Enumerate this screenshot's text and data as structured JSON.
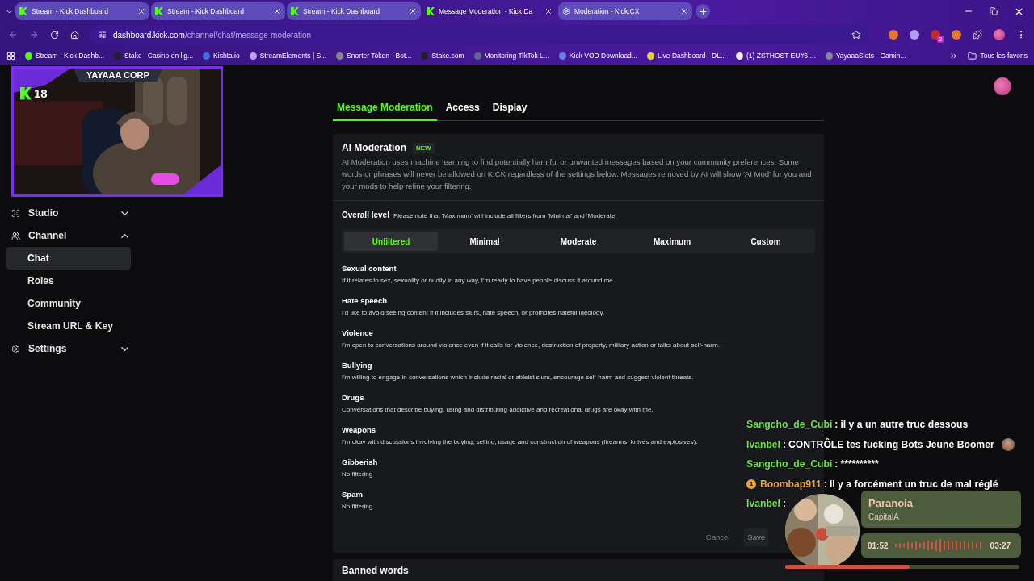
{
  "browser": {
    "tabs": [
      {
        "label": "Stream - Kick Dashboard",
        "kind": "kick",
        "selected": false
      },
      {
        "label": "Stream - Kick Dashboard",
        "kind": "kick",
        "selected": false
      },
      {
        "label": "Stream - Kick Dashboard",
        "kind": "kick",
        "selected": false
      },
      {
        "label": "Message Moderation - Kick Da",
        "kind": "kick",
        "selected": true
      },
      {
        "label": "Moderation - Kick.CX",
        "kind": "cx",
        "selected": false
      }
    ],
    "url": {
      "host": "dashboard.kick.com",
      "path": "/channel/chat/message-moderation"
    },
    "bookmarks": [
      "Stream - Kick Dashb...",
      "Stake : Casino en lig...",
      "Kishta.io",
      "StreamElements | S...",
      "Snorter Token - Bot...",
      "Stake.com",
      "Monitoring TikTok L...",
      "Kick VOD Download...",
      "Live Dashboard - DL...",
      "(1) ZSTHOST EU#6-...",
      "YayaaaSlots - Gamin..."
    ],
    "all_bookmarks": "Tous les favoris",
    "extension_badge": "2"
  },
  "webcam": {
    "banner": "YAYAAA CORP",
    "badge": "18"
  },
  "sidebar": {
    "items": [
      {
        "label": "Studio",
        "expanded": false
      },
      {
        "label": "Channel",
        "expanded": true,
        "children": [
          {
            "label": "Chat",
            "selected": true
          },
          {
            "label": "Roles",
            "selected": false
          },
          {
            "label": "Community",
            "selected": false
          },
          {
            "label": "Stream URL & Key",
            "selected": false
          }
        ]
      },
      {
        "label": "Settings",
        "expanded": false
      }
    ]
  },
  "page_tabs": [
    {
      "label": "Message Moderation",
      "selected": true
    },
    {
      "label": "Access",
      "selected": false
    },
    {
      "label": "Display",
      "selected": false
    }
  ],
  "ai_moderation": {
    "title": "AI Moderation",
    "badge": "NEW",
    "description": "AI Moderation uses machine learning to find potentially harmful or unwanted messages based on your community preferences. Some words or phrases will never be allowed on KICK regardless of the settings below. Messages removed by AI will show 'AI Mod' for you and your mods to help refine your filtering.",
    "level_label": "Overall level",
    "level_note": "Please note that 'Maximum' will include all filters from 'Minimal' and 'Moderate'",
    "levels": [
      {
        "label": "Unfiltered",
        "selected": true
      },
      {
        "label": "Minimal",
        "selected": false
      },
      {
        "label": "Moderate",
        "selected": false
      },
      {
        "label": "Maximum",
        "selected": false
      },
      {
        "label": "Custom",
        "selected": false
      }
    ],
    "categories": [
      {
        "title": "Sexual content",
        "description": "If it relates to sex, sexuality or nudity in any way, I'm ready to have people discuss it around me."
      },
      {
        "title": "Hate speech",
        "description": "I'd like to avoid seeing content if it includes slurs, hate speech, or promotes hateful ideology."
      },
      {
        "title": "Violence",
        "description": "I'm open to conversations around violence even if it calls for violence, destruction of property, military action or talks about self-harm."
      },
      {
        "title": "Bullying",
        "description": "I'm willing to engage in conversations which include racial or ableist slurs, encourage self-harm and suggest violent threats."
      },
      {
        "title": "Drugs",
        "description": "Conversations that describe buying, using and distributing addictive and recreational drugs are okay with me."
      },
      {
        "title": "Weapons",
        "description": "I'm okay with discussions involving the buying, selling, usage and construction of weapons (firearms, knives and explosives)."
      },
      {
        "title": "Gibberish",
        "description": "No filtering"
      },
      {
        "title": "Spam",
        "description": "No filtering"
      }
    ],
    "cancel": "Cancel",
    "save": "Save"
  },
  "banned_words": {
    "title": "Banned words"
  },
  "chat_overlay": {
    "messages": [
      {
        "user": "Sangcho_de_Cubi",
        "color": "#6fe048",
        "separator": ":",
        "text": "il y a un autre truc dessous",
        "emote": false
      },
      {
        "user": "Ivanbel",
        "color": "#6fe048",
        "separator": ":",
        "text": "CONTRÔLE tes fucking Bots Jeune Boomer",
        "emote": true
      },
      {
        "user": "Sangcho_de_Cubi",
        "color": "#6fe048",
        "separator": ":",
        "text": "**********",
        "emote": false
      },
      {
        "user": "Boombap911",
        "color": "#e9a43c",
        "badge": "1",
        "separator": ":",
        "text": "Il y a forcément un truc de mal réglé",
        "emote": false
      },
      {
        "user": "Ivanbel",
        "color": "#6fe048",
        "separator": ":",
        "emote": false
      }
    ]
  },
  "player": {
    "title": "Paranoia",
    "artist": "CapitalA",
    "elapsed": "01:52",
    "total": "03:27",
    "level": 0.53
  }
}
